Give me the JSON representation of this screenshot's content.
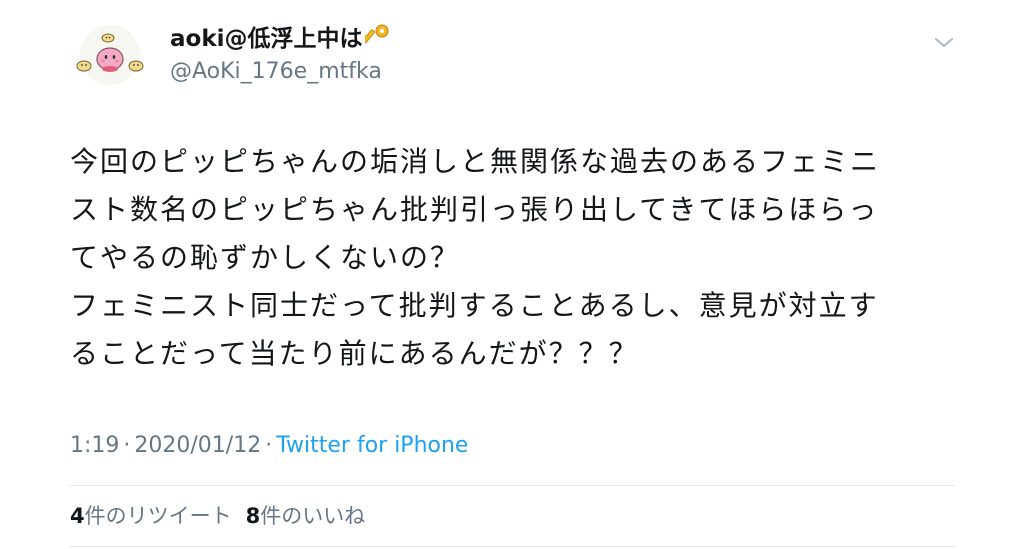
{
  "user": {
    "display_name": "aoki@低浮上中は",
    "handle": "@AoKi_176e_mtfka",
    "name_emoji_icon": "key-icon",
    "avatar_icon": "kirby-like-pink-character-icon"
  },
  "tweet": {
    "text": "今回のピッピちゃんの垢消しと無関係な過去のあるフェミニ\nスト数名のピッピちゃん批判引っ張り出してきてほらほらっ\nてやるの恥ずかしくないの？\nフェミニスト同士だって批判することあるし、意見が対立す\nることだって当たり前にあるんだが？？？",
    "time": "1:19",
    "separator": "·",
    "date": "2020/01/12",
    "source": "Twitter for iPhone"
  },
  "stats": {
    "retweet_count": "4",
    "retweet_label": "件のリツイート",
    "like_count": "8",
    "like_label": "件のいいね"
  },
  "colors": {
    "text": "#14171a",
    "secondary": "#657786",
    "link": "#1da1f2",
    "divider": "#e1e8ed"
  }
}
